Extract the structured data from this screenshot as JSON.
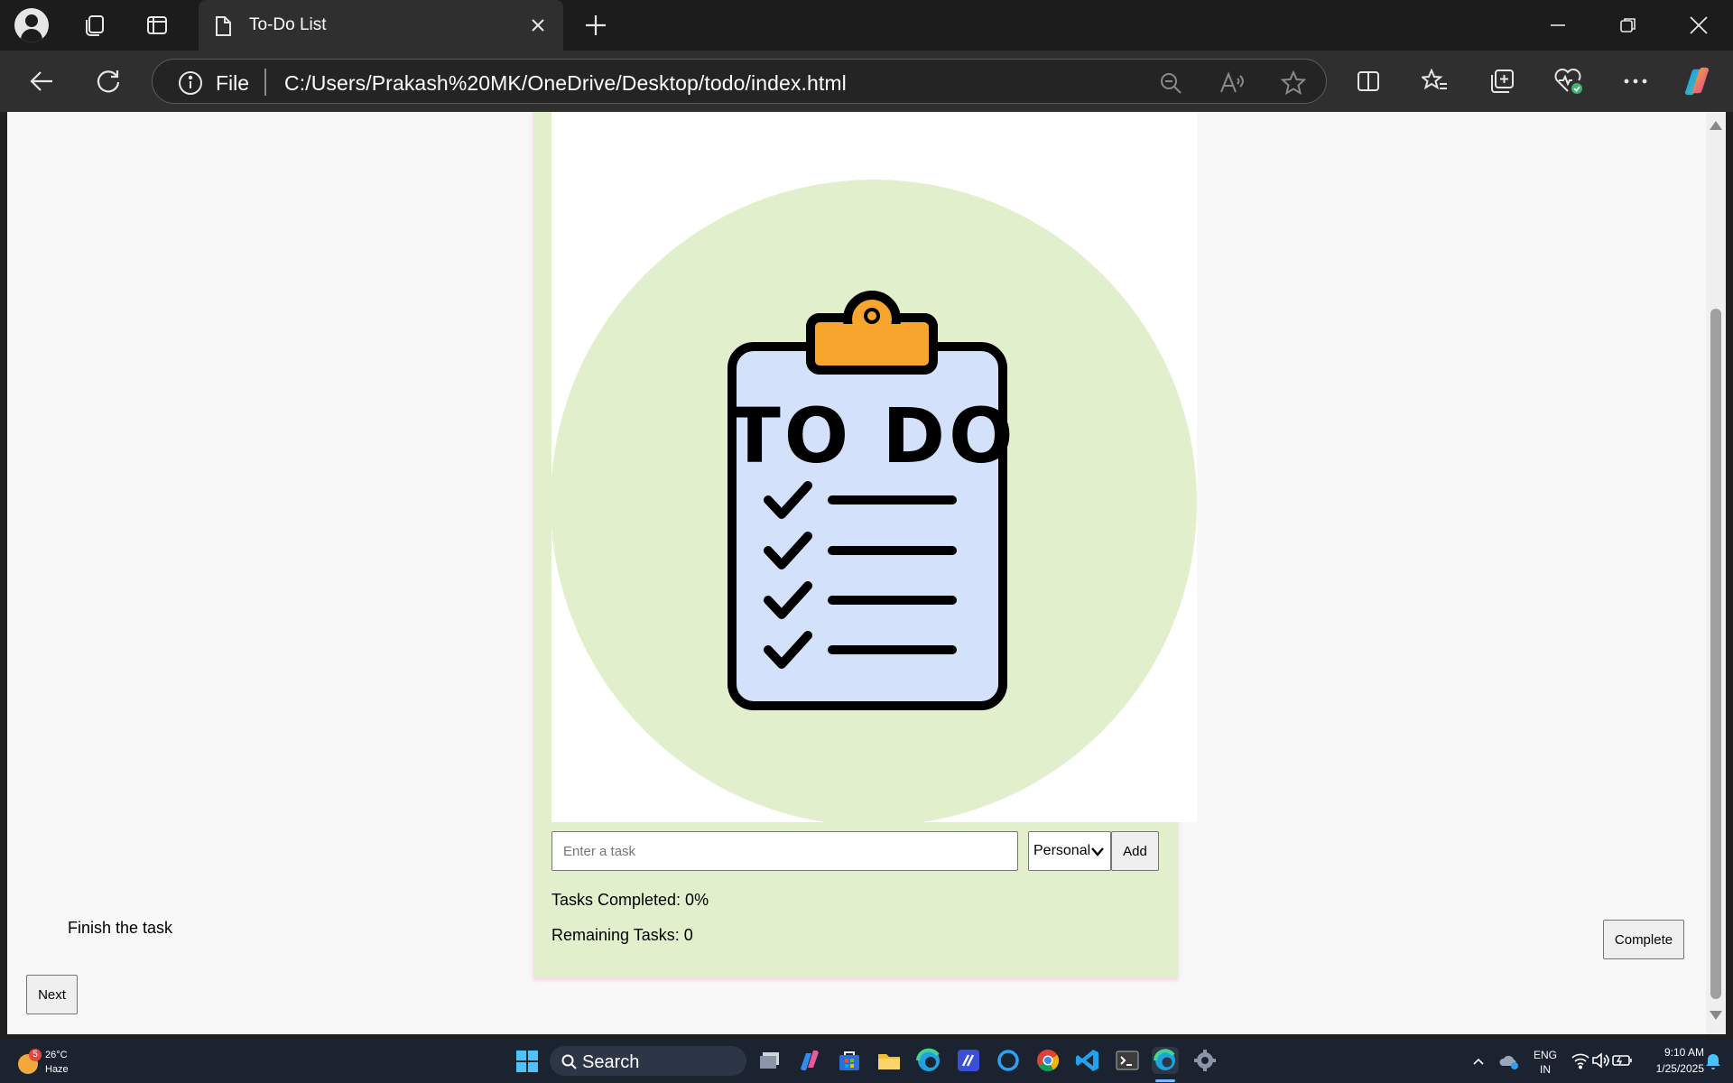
{
  "browser": {
    "tab_title": "To-Do List",
    "address_scheme": "File",
    "address_url": "C:/Users/Prakash%20MK/OneDrive/Desktop/todo/index.html"
  },
  "page": {
    "hero_text": "TO DO",
    "task_placeholder": "Enter a task",
    "category_selected": "Personal",
    "add_label": "Add",
    "tasks_completed": "Tasks Completed: 0%",
    "remaining_tasks": "Remaining Tasks: 0",
    "task_item": "Finish the task",
    "complete_label": "Complete",
    "next_label": "Next",
    "colors": {
      "card_bg": "#e2efcc",
      "clipboard_fill": "#d3e1fb",
      "clip_fill": "#f7a52c"
    }
  },
  "taskbar": {
    "weather_badge": "5",
    "weather_temp": "26°C",
    "weather_condition": "Haze",
    "search_label": "Search",
    "lang_primary": "ENG",
    "lang_secondary": "IN",
    "time": "9:10 AM",
    "date": "1/25/2025"
  },
  "icons": [
    "profile-icon",
    "workspaces-icon",
    "tab-actions-icon",
    "document-icon",
    "close-tab-icon",
    "new-tab-icon",
    "minimize-icon",
    "restore-icon",
    "close-window-icon",
    "back-icon",
    "refresh-icon",
    "info-icon",
    "zoom-out-icon",
    "read-aloud-icon",
    "favorite-star-icon",
    "split-screen-icon",
    "favorites-icon",
    "collections-icon",
    "browser-essentials-icon",
    "more-icon",
    "copilot-icon"
  ]
}
